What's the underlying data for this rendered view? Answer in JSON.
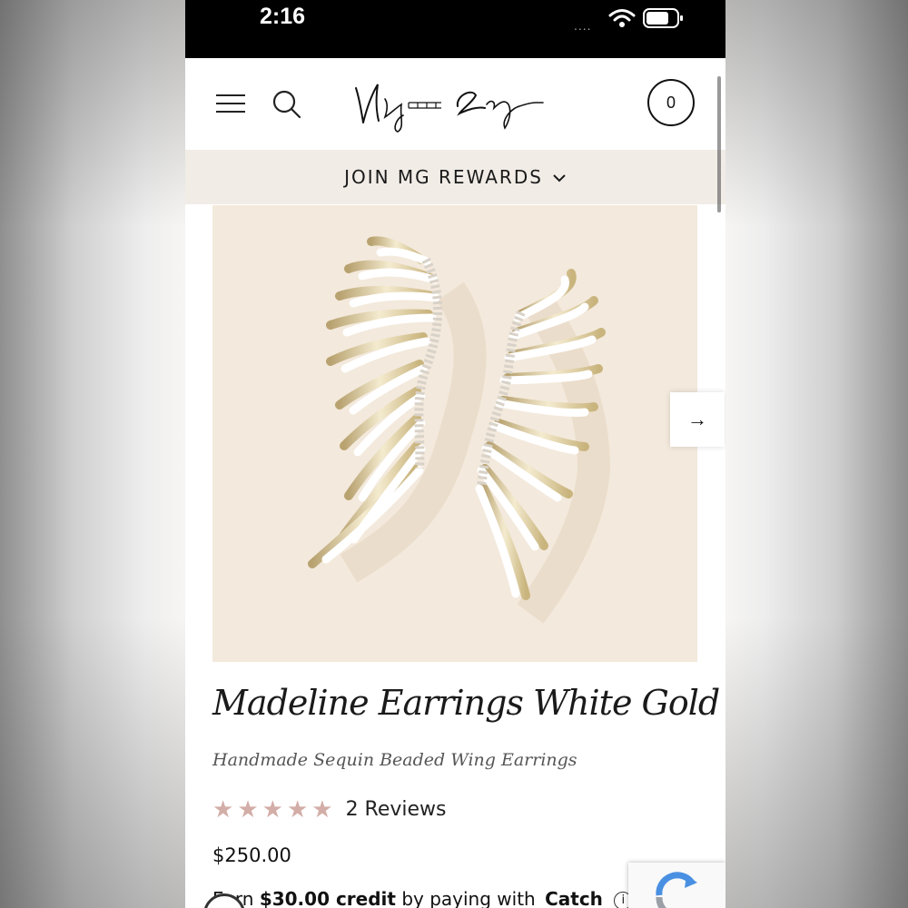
{
  "status_bar": {
    "time": "2:16",
    "signal": "....",
    "icons": [
      "wifi-icon",
      "battery-icon"
    ]
  },
  "header": {
    "brand": "Mignonne Gavigan",
    "cart_count": "0",
    "icons": [
      "menu-icon",
      "search-icon"
    ]
  },
  "rewards_bar": {
    "label": "JOIN MG REWARDS"
  },
  "product": {
    "title": "Madeline Earrings White Gold",
    "subtitle": "Handmade Sequin Beaded Wing Earrings",
    "rating": 5,
    "reviews": "2 Reviews",
    "price": "$250.00",
    "credit_prefix": "Earn",
    "credit_amount": "$30.00 credit",
    "credit_mid": "by paying with",
    "credit_brand": "Catch",
    "info_glyph": "i"
  },
  "gallery": {
    "next_arrow": "→"
  },
  "colors": {
    "rewards_bg": "#f1ece6",
    "image_bg": "#f3e9dc",
    "star": "#d3ada7",
    "status_bar": "#000000"
  }
}
